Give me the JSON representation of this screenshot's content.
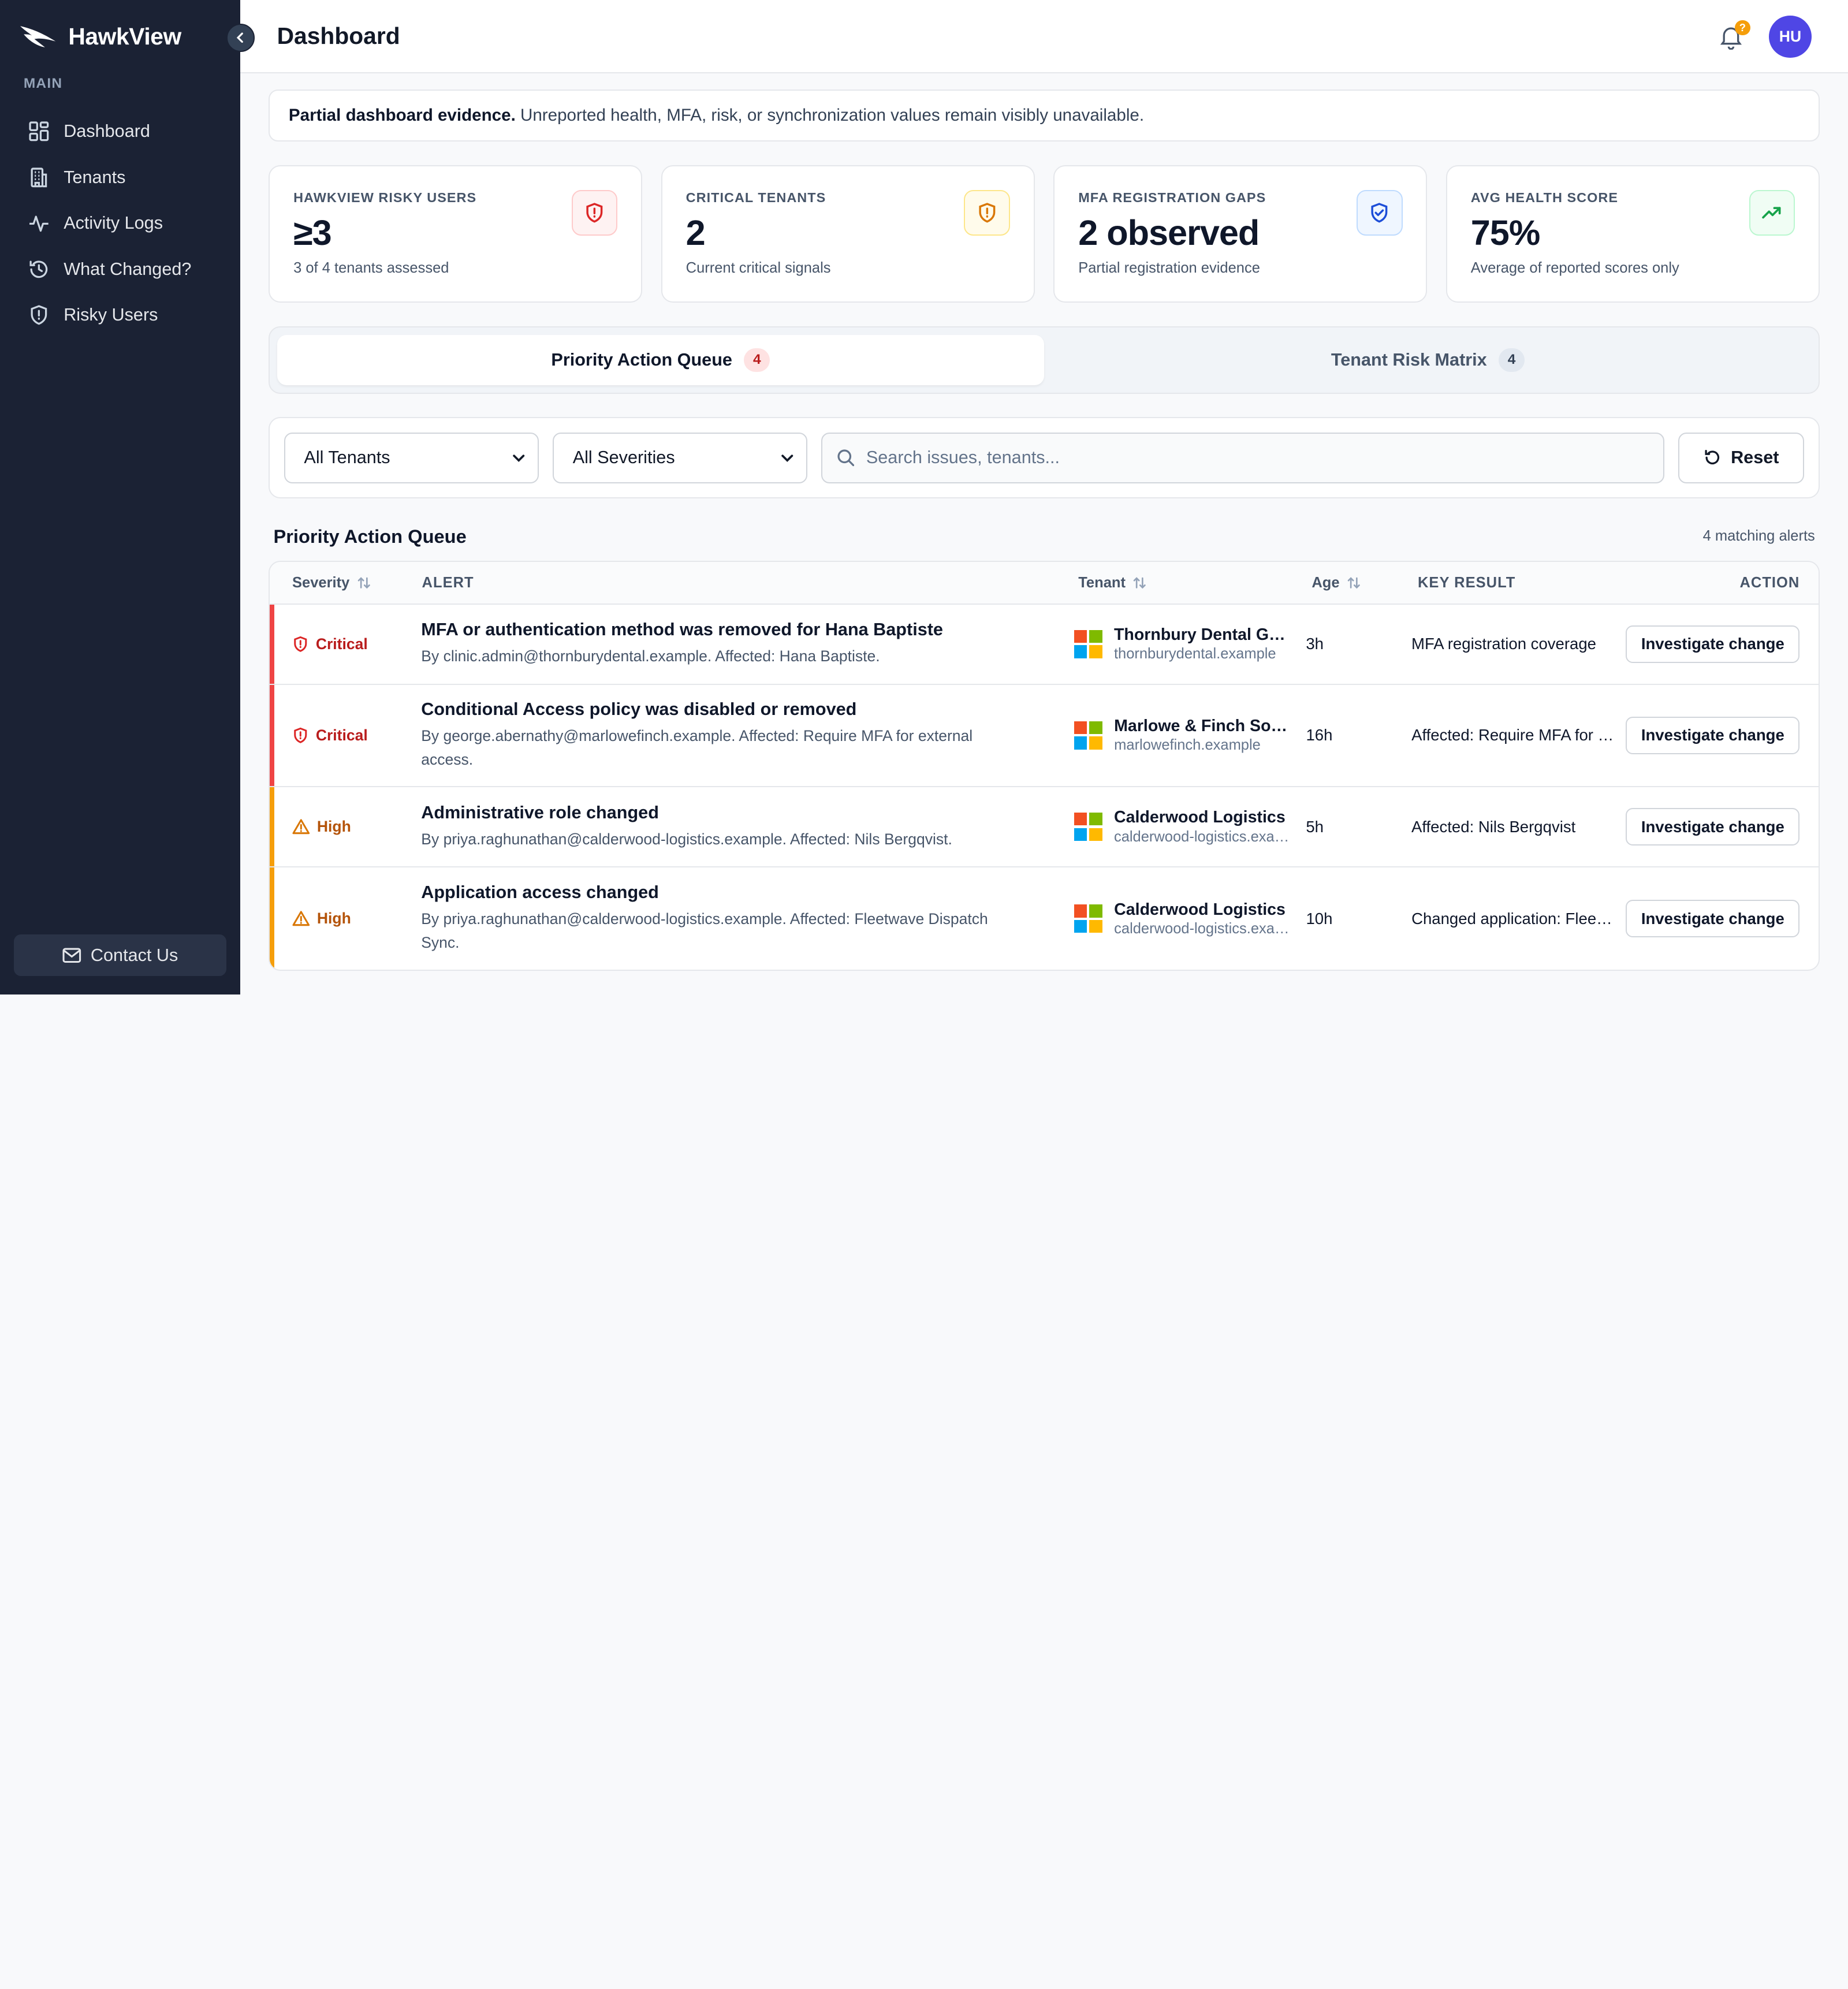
{
  "brand": {
    "name": "HawkView"
  },
  "sidebar": {
    "section_label": "MAIN",
    "items": [
      {
        "label": "Dashboard",
        "icon": "grid-icon"
      },
      {
        "label": "Tenants",
        "icon": "building-icon"
      },
      {
        "label": "Activity Logs",
        "icon": "activity-icon"
      },
      {
        "label": "What Changed?",
        "icon": "history-icon"
      },
      {
        "label": "Risky Users",
        "icon": "shield-icon"
      }
    ],
    "contact_label": "Contact Us"
  },
  "header": {
    "title": "Dashboard",
    "notification_badge": "?",
    "avatar_initials": "HU"
  },
  "notice": {
    "strong": "Partial dashboard evidence.",
    "text": "Unreported health, MFA, risk, or synchronization values remain visibly unavailable."
  },
  "cards": [
    {
      "label": "HAWKVIEW RISKY USERS",
      "value": "≥3",
      "sub": "3 of 4 tenants assessed",
      "color": "#dc2626"
    },
    {
      "label": "CRITICAL TENANTS",
      "value": "2",
      "sub": "Current critical signals",
      "color": "#d97706"
    },
    {
      "label": "MFA REGISTRATION GAPS",
      "value": "2 observed",
      "sub": "Partial registration evidence",
      "color": "#1d4ed8"
    },
    {
      "label": "AVG HEALTH SCORE",
      "value": "75%",
      "sub": "Average of reported scores only",
      "color": "#16a34a"
    }
  ],
  "tabs": [
    {
      "label": "Priority Action Queue",
      "count": "4"
    },
    {
      "label": "Tenant Risk Matrix",
      "count": "4"
    }
  ],
  "filters": {
    "tenant_select": "All Tenants",
    "severity_select": "All Severities",
    "search_placeholder": "Search issues, tenants...",
    "reset_label": "Reset"
  },
  "queue": {
    "title": "Priority Action Queue",
    "count_text": "4 matching alerts",
    "columns": {
      "severity": "Severity",
      "alert": "ALERT",
      "tenant": "Tenant",
      "age": "Age",
      "key_result": "KEY RESULT",
      "action": "ACTION"
    },
    "rows": [
      {
        "severity": "Critical",
        "title": "MFA or authentication method was removed for Hana Baptiste",
        "desc": "By clinic.admin@thornburydental.example. Affected: Hana Baptiste.",
        "tenant_name": "Thornbury Dental Group",
        "tenant_domain": "thornburydental.example",
        "age": "3h",
        "key_result": "MFA registration coverage",
        "action": "Investigate change"
      },
      {
        "severity": "Critical",
        "title": "Conditional Access policy was disabled or removed",
        "desc": "By george.abernathy@marlowefinch.example. Affected: Require MFA for external access.",
        "tenant_name": "Marlowe & Finch Solicitors",
        "tenant_domain": "marlowefinch.example",
        "age": "16h",
        "key_result": "Affected: Require MFA for external access",
        "action": "Investigate change"
      },
      {
        "severity": "High",
        "title": "Administrative role changed",
        "desc": "By priya.raghunathan@calderwood-logistics.example. Affected: Nils Bergqvist.",
        "tenant_name": "Calderwood Logistics",
        "tenant_domain": "calderwood-logistics.example",
        "age": "5h",
        "key_result": "Affected: Nils Bergqvist",
        "action": "Investigate change"
      },
      {
        "severity": "High",
        "title": "Application access changed",
        "desc": "By priya.raghunathan@calderwood-logistics.example. Affected: Fleetwave Dispatch Sync.",
        "tenant_name": "Calderwood Logistics",
        "tenant_domain": "calderwood-logistics.example",
        "age": "10h",
        "key_result": "Changed application: Fleetwave Dispatch Sync",
        "action": "Investigate change"
      }
    ]
  },
  "colors": {
    "sidebar_bg": "#1b2234",
    "critical": "#dc2626",
    "high": "#f59e0b",
    "avatar": "#4f46e5"
  }
}
